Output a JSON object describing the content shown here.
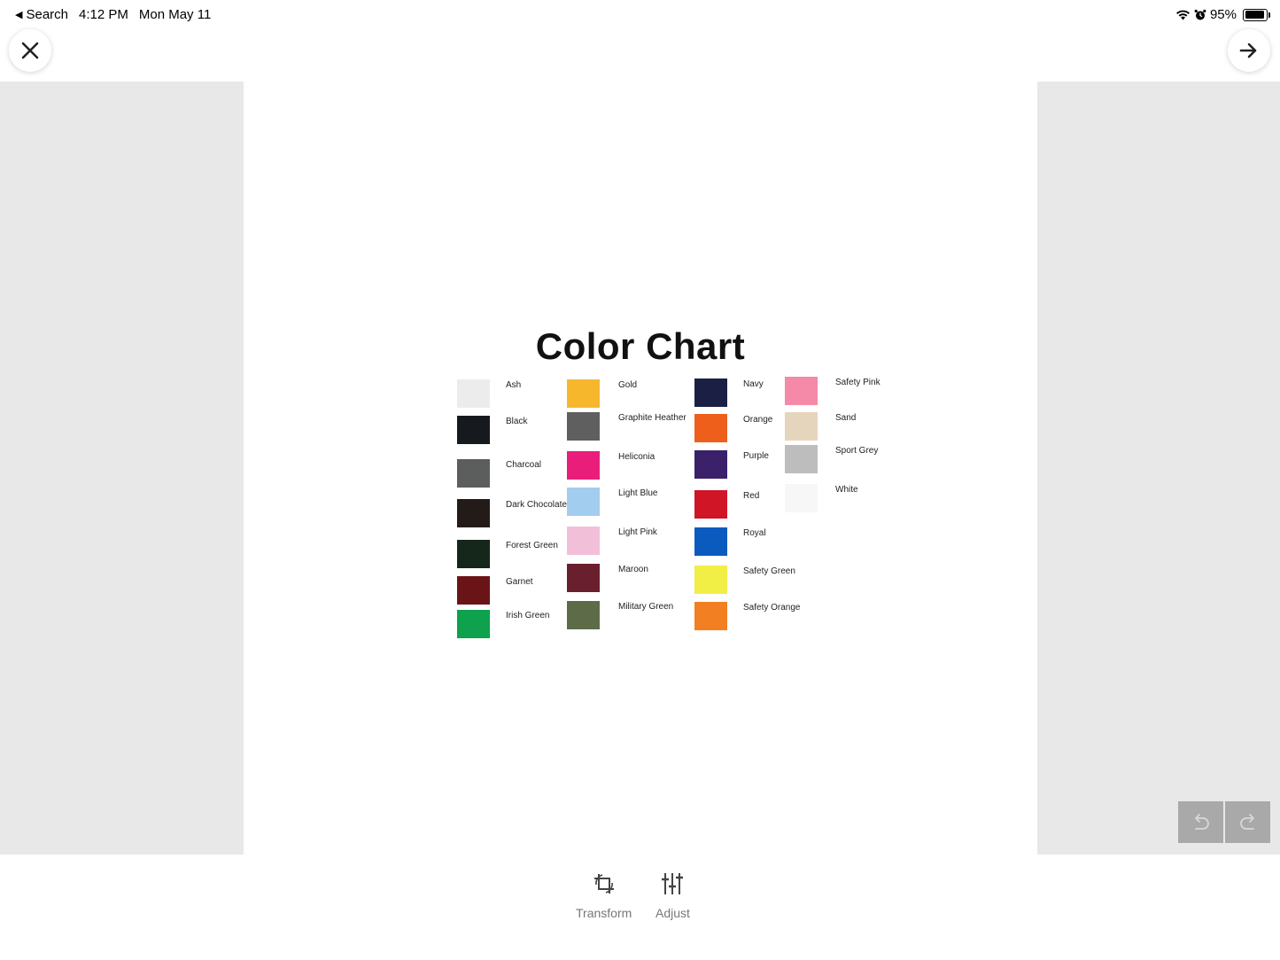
{
  "status_bar": {
    "back_label": "Search",
    "time": "4:12 PM",
    "date": "Mon May 11",
    "battery_text": "95%",
    "battery_level": 0.95
  },
  "icons": {
    "close": "close-icon",
    "next": "arrow-right-icon",
    "undo": "undo-icon",
    "redo": "redo-icon",
    "transform": "crop-rotate-icon",
    "adjust": "sliders-icon"
  },
  "image": {
    "title": "Color Chart",
    "swatches": [
      {
        "label": "Ash",
        "color": "#ececec"
      },
      {
        "label": "Black",
        "color": "#161a1e"
      },
      {
        "label": "Charcoal",
        "color": "#5c5d5d"
      },
      {
        "label": "Dark Chocolate",
        "color": "#231b18"
      },
      {
        "label": "Forest Green",
        "color": "#15261a"
      },
      {
        "label": "Garnet",
        "color": "#6a1418"
      },
      {
        "label": "Irish Green",
        "color": "#0ea14e"
      },
      {
        "label": "Gold",
        "color": "#f6b72d"
      },
      {
        "label": "Graphite Heather",
        "color": "#5f5f5f"
      },
      {
        "label": "Heliconia",
        "color": "#e91e7b"
      },
      {
        "label": "Light Blue",
        "color": "#a3cdee"
      },
      {
        "label": "Light Pink",
        "color": "#f2bfd9"
      },
      {
        "label": "Maroon",
        "color": "#6a1f2e"
      },
      {
        "label": "Military Green",
        "color": "#5e6b49"
      },
      {
        "label": "Navy",
        "color": "#1c1f44"
      },
      {
        "label": "Orange",
        "color": "#ee5f1c"
      },
      {
        "label": "Purple",
        "color": "#3a2169"
      },
      {
        "label": "Red",
        "color": "#cf1526"
      },
      {
        "label": "Royal",
        "color": "#0b5bbf"
      },
      {
        "label": "Safety Green",
        "color": "#f1ef46"
      },
      {
        "label": "Safety Orange",
        "color": "#f27f21"
      },
      {
        "label": "Safety Pink",
        "color": "#f58aa8"
      },
      {
        "label": "Sand",
        "color": "#e5d5bc"
      },
      {
        "label": "Sport Grey",
        "color": "#bdbdbd"
      },
      {
        "label": "White",
        "color": "#f7f7f7"
      }
    ]
  },
  "toolbar": {
    "transform_label": "Transform",
    "adjust_label": "Adjust"
  }
}
